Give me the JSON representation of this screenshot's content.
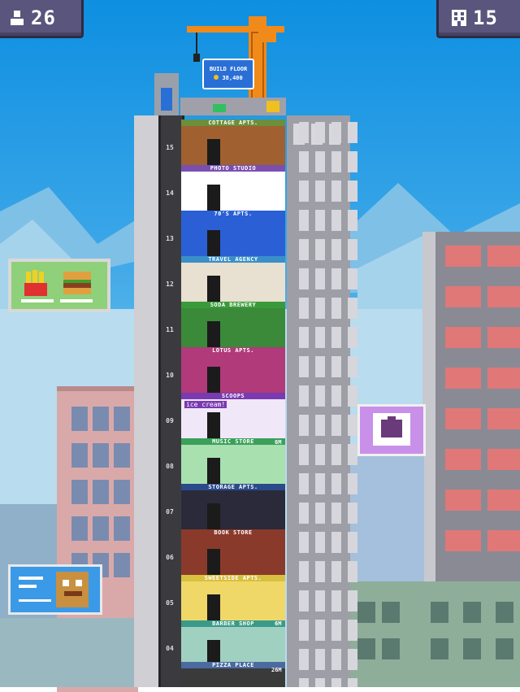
{
  "hud": {
    "population": "26",
    "floors": "15",
    "population_icon": "people-icon",
    "floors_icon": "building-icon"
  },
  "build_button": {
    "label": "BUILD FLOOR",
    "cost": "38,400"
  },
  "floors": [
    {
      "num": "15",
      "name": "COTTAGE APTS.",
      "color": "#6b8f3a"
    },
    {
      "num": "14",
      "name": "PHOTO STUDIO",
      "color": "#7a4fb0"
    },
    {
      "num": "13",
      "name": "70'S APTS.",
      "color": "#2a5fd6"
    },
    {
      "num": "12",
      "name": "TRAVEL AGENCY",
      "color": "#3a8fc8"
    },
    {
      "num": "11",
      "name": "SODA BREWERY",
      "color": "#3a9a3a"
    },
    {
      "num": "10",
      "name": "LOTUS APTS.",
      "color": "#b03a7a"
    },
    {
      "num": "09",
      "name": "SCOOPS",
      "color": "#7a3ab0"
    },
    {
      "num": "08",
      "name": "MUSIC STORE",
      "color": "#3aa05a"
    },
    {
      "num": "07",
      "name": "STORAGE APTS.",
      "color": "#2a4a8a"
    },
    {
      "num": "06",
      "name": "BOOK STORE",
      "color": "#8a3a2a"
    },
    {
      "num": "05",
      "name": "SWEETSIDE APTS.",
      "color": "#d8c040"
    },
    {
      "num": "04",
      "name": "BARBER SHOP",
      "color": "#3a9a8a"
    }
  ],
  "bottom_floor_label": "PIZZA PLACE",
  "ice_cream_sign": "ice cream!",
  "floor_badges": [
    "6M",
    "6M",
    "26M"
  ],
  "colors": {
    "sky": "#3aa6e8",
    "hud_bg": "#5a557c",
    "crane": "#f08a1a",
    "build_button": "#2a6fd6"
  }
}
